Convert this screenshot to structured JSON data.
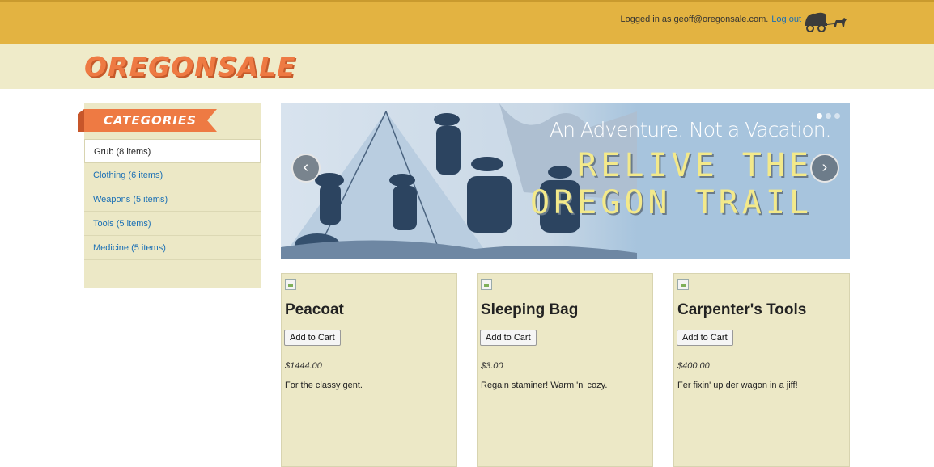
{
  "header": {
    "login_prefix": "Logged in as geoff@oregonsale.com.",
    "logout_label": "Log out",
    "wagon_icon": "covered-wagon-icon"
  },
  "brand": {
    "logo_text": "OREGONSALE"
  },
  "sidebar": {
    "title": "CATEGORIES",
    "items": [
      {
        "label": "Grub (8 items)",
        "active": true
      },
      {
        "label": "Clothing (6 items)",
        "active": false
      },
      {
        "label": "Weapons (5 items)",
        "active": false
      },
      {
        "label": "Tools (5 items)",
        "active": false
      },
      {
        "label": "Medicine (5 items)",
        "active": false
      }
    ]
  },
  "banner": {
    "tagline": "An Adventure. Not a Vacation.",
    "headline_1": "RELIVE THE",
    "headline_2": "OREGON TRAIL",
    "prev_icon": "chevron-left-icon",
    "next_icon": "chevron-right-icon",
    "slides_total": 3,
    "active_slide": 1
  },
  "products": [
    {
      "name": "Peacoat",
      "button_label": "Add to Cart",
      "price": "$1444.00",
      "description": "For the classy gent."
    },
    {
      "name": "Sleeping Bag",
      "button_label": "Add to Cart",
      "price": "$3.00",
      "description": "Regain staminer! Warm 'n' cozy."
    },
    {
      "name": "Carpenter's Tools",
      "button_label": "Add to Cart",
      "price": "$400.00",
      "description": "Fer fixin' up der wagon in a jiff!"
    }
  ],
  "colors": {
    "topbar": "#e3b341",
    "brandbar": "#efebc9",
    "logo": "#ee7a43",
    "ribbon": "#ee7a43",
    "link": "#1a6fb5",
    "banner_bg": "#a7c4dd",
    "headline": "#f3e98a"
  }
}
